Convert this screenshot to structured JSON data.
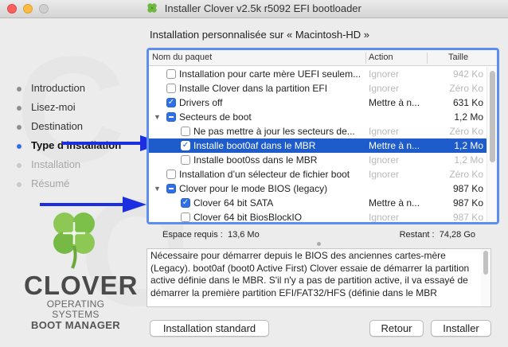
{
  "window": {
    "title": "Installer Clover v2.5k r5092 EFI bootloader",
    "title_icon": "clover-icon"
  },
  "sidebar": {
    "steps": [
      {
        "label": "Introduction",
        "state": "done"
      },
      {
        "label": "Lisez-moi",
        "state": "done"
      },
      {
        "label": "Destination",
        "state": "done"
      },
      {
        "label": "Type d’installation",
        "state": "current"
      },
      {
        "label": "Installation",
        "state": "disabled"
      },
      {
        "label": "Résumé",
        "state": "disabled"
      }
    ],
    "logo": {
      "brand": "CLOVER",
      "line1": "OPERATING SYSTEMS",
      "line2": "BOOT MANAGER",
      "icon": "four-leaf-clover-logo"
    }
  },
  "main": {
    "heading": "Installation personnalisée sur « Macintosh-HD »",
    "table": {
      "columns": [
        "Nom du paquet",
        "Action",
        "Taille"
      ],
      "rows": [
        {
          "name": "Installation pour carte mère UEFI seulem...",
          "action": "Ignorer",
          "size": "942 Ko",
          "checkbox": "off",
          "disclosure": "",
          "dim": true,
          "selected": false
        },
        {
          "name": "Installe Clover dans la partition EFI",
          "action": "Ignorer",
          "size": "Zéro Ko",
          "checkbox": "off",
          "disclosure": "",
          "dim": true,
          "selected": false
        },
        {
          "name": "Drivers off",
          "action": "Mettre à n...",
          "size": "631 Ko",
          "checkbox": "on",
          "disclosure": "",
          "dim": false,
          "selected": false
        },
        {
          "name": "Secteurs de boot",
          "action": "",
          "size": "1,2 Mo",
          "checkbox": "mixed",
          "disclosure": "▼",
          "dim": false,
          "selected": false
        },
        {
          "name": "Ne pas mettre à jour les secteurs de...",
          "action": "Ignorer",
          "size": "Zéro Ko",
          "checkbox": "off",
          "disclosure": "",
          "dim": true,
          "selected": false,
          "indent": true
        },
        {
          "name": "Installe boot0af dans le MBR",
          "action": "Mettre à n...",
          "size": "1,2 Mo",
          "checkbox": "on",
          "disclosure": "",
          "dim": false,
          "selected": true,
          "indent": true
        },
        {
          "name": "Installe boot0ss dans le MBR",
          "action": "Ignorer",
          "size": "1,2 Mo",
          "checkbox": "off",
          "disclosure": "",
          "dim": true,
          "selected": false,
          "indent": true
        },
        {
          "name": "Installation d’un sélecteur de fichier boot",
          "action": "Ignorer",
          "size": "Zéro Ko",
          "checkbox": "off",
          "disclosure": "",
          "dim": true,
          "selected": false
        },
        {
          "name": "Clover pour le mode BIOS (legacy)",
          "action": "",
          "size": "987 Ko",
          "checkbox": "mixed",
          "disclosure": "▼",
          "dim": false,
          "selected": false
        },
        {
          "name": "Clover 64 bit SATA",
          "action": "Mettre à n...",
          "size": "987 Ko",
          "checkbox": "on",
          "disclosure": "",
          "dim": false,
          "selected": false,
          "indent": true
        },
        {
          "name": "Clover 64 bit BiosBlockIO",
          "action": "Ignorer",
          "size": "987 Ko",
          "checkbox": "off",
          "disclosure": "",
          "dim": true,
          "selected": false,
          "indent": true
        }
      ]
    },
    "space": {
      "required_label": "Espace requis :",
      "required_value": "13,6 Mo",
      "remaining_label": "Restant :",
      "remaining_value": "74,28 Go"
    },
    "description": "Nécessaire pour démarrer depuis le BIOS des anciennes cartes-mère (Legacy). boot0af (boot0 Active First) Clover essaie de démarrer la partition active définie dans le MBR. S'il n'y a pas de partition active, il va essayé de démarrer la première partition EFI/FAT32/HFS (définie dans le MBR",
    "buttons": {
      "standard": "Installation standard",
      "back": "Retour",
      "install": "Installer"
    }
  },
  "annotations": {
    "arrow_color": "#1b2fe0"
  },
  "colors": {
    "accent": "#2f6fe8",
    "selection": "#1e5ccc",
    "focus_ring": "#5b8ef0",
    "clover_green": "#7cc04a"
  }
}
